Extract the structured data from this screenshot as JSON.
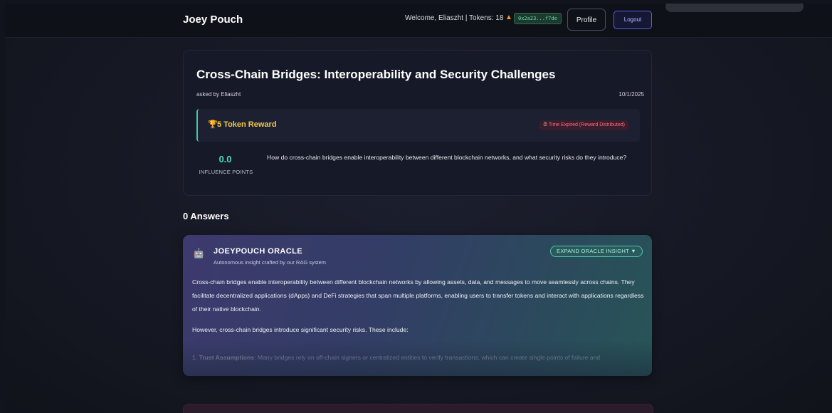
{
  "header": {
    "brand": "Joey Pouch",
    "welcome": "Welcome, Eliaszht | Tokens: 18",
    "wallet": "0x2a23...f7de",
    "profile_label": "Profile",
    "logout_label": "Logout"
  },
  "question": {
    "title": "Cross-Chain Bridges: Interoperability and Security Challenges",
    "asked_by": "asked by Eliaszht",
    "date": "10/1/2025",
    "reward_label": "5 Token Reward",
    "expired_label": "Time Expired (Reward Distributed)",
    "influence_value": "0.0",
    "influence_label": "INFLUENCE POINTS",
    "body": "How do cross-chain bridges enable interoperability between different blockchain networks, and what security risks do they introduce?"
  },
  "answers": {
    "heading": "0 Answers"
  },
  "oracle": {
    "title": "JOEYPOUCH ORACLE",
    "subtitle": "Autonomous insight crafted by our RAG system",
    "expand_label": "EXPAND ORACLE INSIGHT ▼",
    "paragraph1": "Cross-chain bridges enable interoperability between different blockchain networks by allowing assets, data, and messages to move seamlessly across chains. They facilitate decentralized applications (dApps) and DeFi strategies that span multiple platforms, enabling users to transfer tokens and interact with applications regardless of their native blockchain.",
    "paragraph2": "However, cross-chain bridges introduce significant security risks. These include:",
    "list_prefix": "1. ",
    "list_term": "Trust Assumptions",
    "list_text": ": Many bridges rely on off-chain signers or centralized entities to verify transactions, which can create single points of failure and"
  },
  "icons": {
    "fox": "metamask-fox-icon",
    "trophy": "trophy-icon",
    "stopwatch": "stopwatch-icon",
    "robot": "robot-icon"
  },
  "colors": {
    "accent_teal": "#4fd6b8",
    "reward_gold": "#f2c94c",
    "expired_red": "#ff6b82",
    "logout_border": "#5a5fd6"
  }
}
